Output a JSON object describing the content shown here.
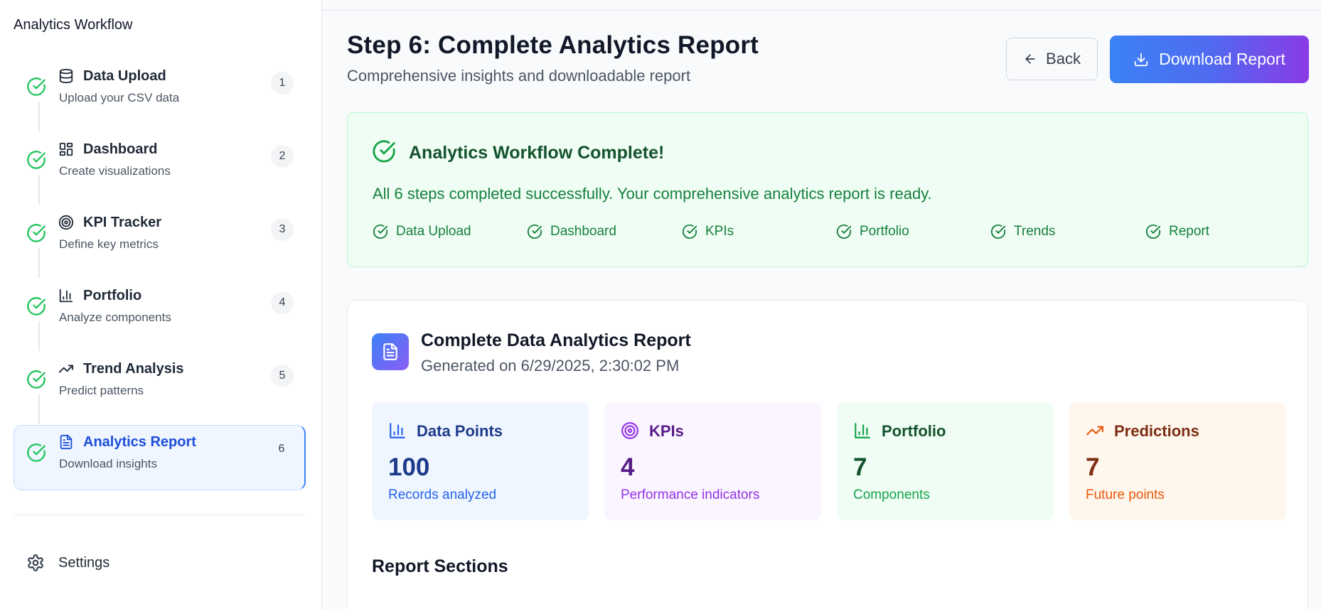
{
  "sidebar": {
    "title": "Analytics Workflow",
    "steps": [
      {
        "label": "Data Upload",
        "sub": "Upload your CSV data",
        "num": "1",
        "icon": "database-icon"
      },
      {
        "label": "Dashboard",
        "sub": "Create visualizations",
        "num": "2",
        "icon": "layout-grid-icon"
      },
      {
        "label": "KPI Tracker",
        "sub": "Define key metrics",
        "num": "3",
        "icon": "target-icon"
      },
      {
        "label": "Portfolio",
        "sub": "Analyze components",
        "num": "4",
        "icon": "bar-chart-icon"
      },
      {
        "label": "Trend Analysis",
        "sub": "Predict patterns",
        "num": "5",
        "icon": "trending-up-icon"
      },
      {
        "label": "Analytics Report",
        "sub": "Download insights",
        "num": "6",
        "icon": "file-text-icon",
        "active": true
      }
    ],
    "settings_label": "Settings"
  },
  "header": {
    "title": "Step 6: Complete Analytics Report",
    "subtitle": "Comprehensive insights and downloadable report",
    "back_label": "Back",
    "download_label": "Download Report"
  },
  "success": {
    "title": "Analytics Workflow Complete!",
    "message": "All 6 steps completed successfully. Your comprehensive analytics report is ready.",
    "items": [
      "Data Upload",
      "Dashboard",
      "KPIs",
      "Portfolio",
      "Trends",
      "Report"
    ]
  },
  "report": {
    "title": "Complete Data Analytics Report",
    "generated": "Generated on 6/29/2025, 2:30:02 PM",
    "stats": [
      {
        "label": "Data Points",
        "value": "100",
        "desc": "Records analyzed",
        "icon": "bar-chart-icon",
        "color": "#2563eb"
      },
      {
        "label": "KPIs",
        "value": "4",
        "desc": "Performance indicators",
        "icon": "target-icon",
        "color": "#9333ea"
      },
      {
        "label": "Portfolio",
        "value": "7",
        "desc": "Components",
        "icon": "bar-chart-icon",
        "color": "#16a34a"
      },
      {
        "label": "Predictions",
        "value": "7",
        "desc": "Future points",
        "icon": "trending-up-icon",
        "color": "#ea580c"
      }
    ],
    "sections_title": "Report Sections"
  },
  "colors": {
    "success_green": "#22c55e",
    "accent_blue": "#3b82f6",
    "accent_purple": "#8b3ae6"
  }
}
